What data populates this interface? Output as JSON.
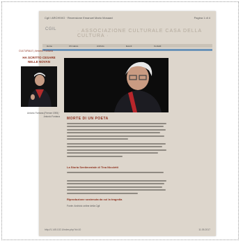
{
  "header": {
    "left": "Cgil / ARCHIVIO · Recensione Emanuel Mario Mosaavi",
    "right": "Pagina 1 di 4"
  },
  "banner": {
    "logo": "CGIL",
    "masthead": "· ASSOCIAZIONE CULTURALE CASA DELLA CULTURA ·"
  },
  "nav": {
    "items": [
      "Home",
      "Chi siamo",
      "Archivio",
      "Eventi",
      "Contatti"
    ]
  },
  "left": {
    "breadcrumb": "CULTURALE | Antonio Fontana",
    "title_line1": "HA SCRITTO CESARE",
    "title_line2": "NELLE NOVAN",
    "caption": "Antonio Fontana (Firenze 1955) · Antonio Fontana"
  },
  "article": {
    "section_title": "MORTE DI UN POETA",
    "subhead1": "La Storia Sentimentale di Tina Nicoletti",
    "subhead2": "Riproduzione sostenuta da cui la tragedia",
    "note": "Fonte: Archivio online della Cgil"
  },
  "footer": {
    "left": "http://1.145.102.1/index.php?id=10",
    "right": "11.05.2017"
  },
  "colors": {
    "accent": "#8d2f1c",
    "bar": "#6a93b8",
    "paper": "#ddd6cc"
  }
}
